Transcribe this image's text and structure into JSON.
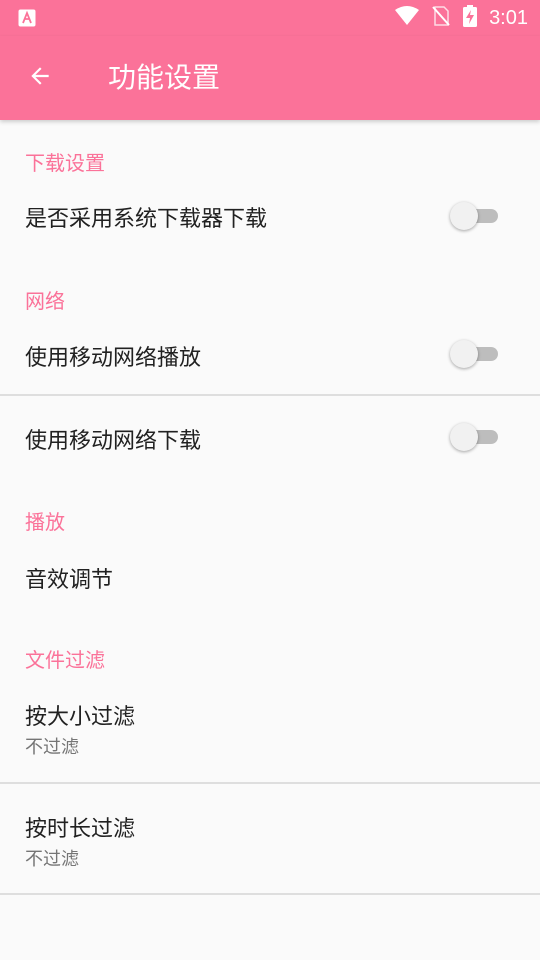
{
  "status_bar": {
    "time": "3:01",
    "left_icon": "a-icon",
    "icons": [
      "wifi-icon",
      "no-sim-icon",
      "battery-charging-icon"
    ]
  },
  "app_bar": {
    "title": "功能设置",
    "back_icon": "arrow-left-icon"
  },
  "sections": [
    {
      "header": "下载设置"
    },
    {
      "header": "网络"
    },
    {
      "header": "播放"
    },
    {
      "header": "文件过滤"
    }
  ],
  "items": {
    "system_downloader": {
      "title": "是否采用系统下载器下载",
      "enabled": false
    },
    "mobile_play": {
      "title": "使用移动网络播放",
      "enabled": false
    },
    "mobile_download": {
      "title": "使用移动网络下载",
      "enabled": false
    },
    "sound_effect": {
      "title": "音效调节"
    },
    "filter_size": {
      "title": "按大小过滤",
      "summary": "不过滤"
    },
    "filter_duration": {
      "title": "按时长过滤",
      "summary": "不过滤"
    }
  },
  "colors": {
    "accent": "#fb7299",
    "background": "#fafafa",
    "text_primary": "#212121",
    "text_secondary": "#757575",
    "divider": "#dedede"
  }
}
